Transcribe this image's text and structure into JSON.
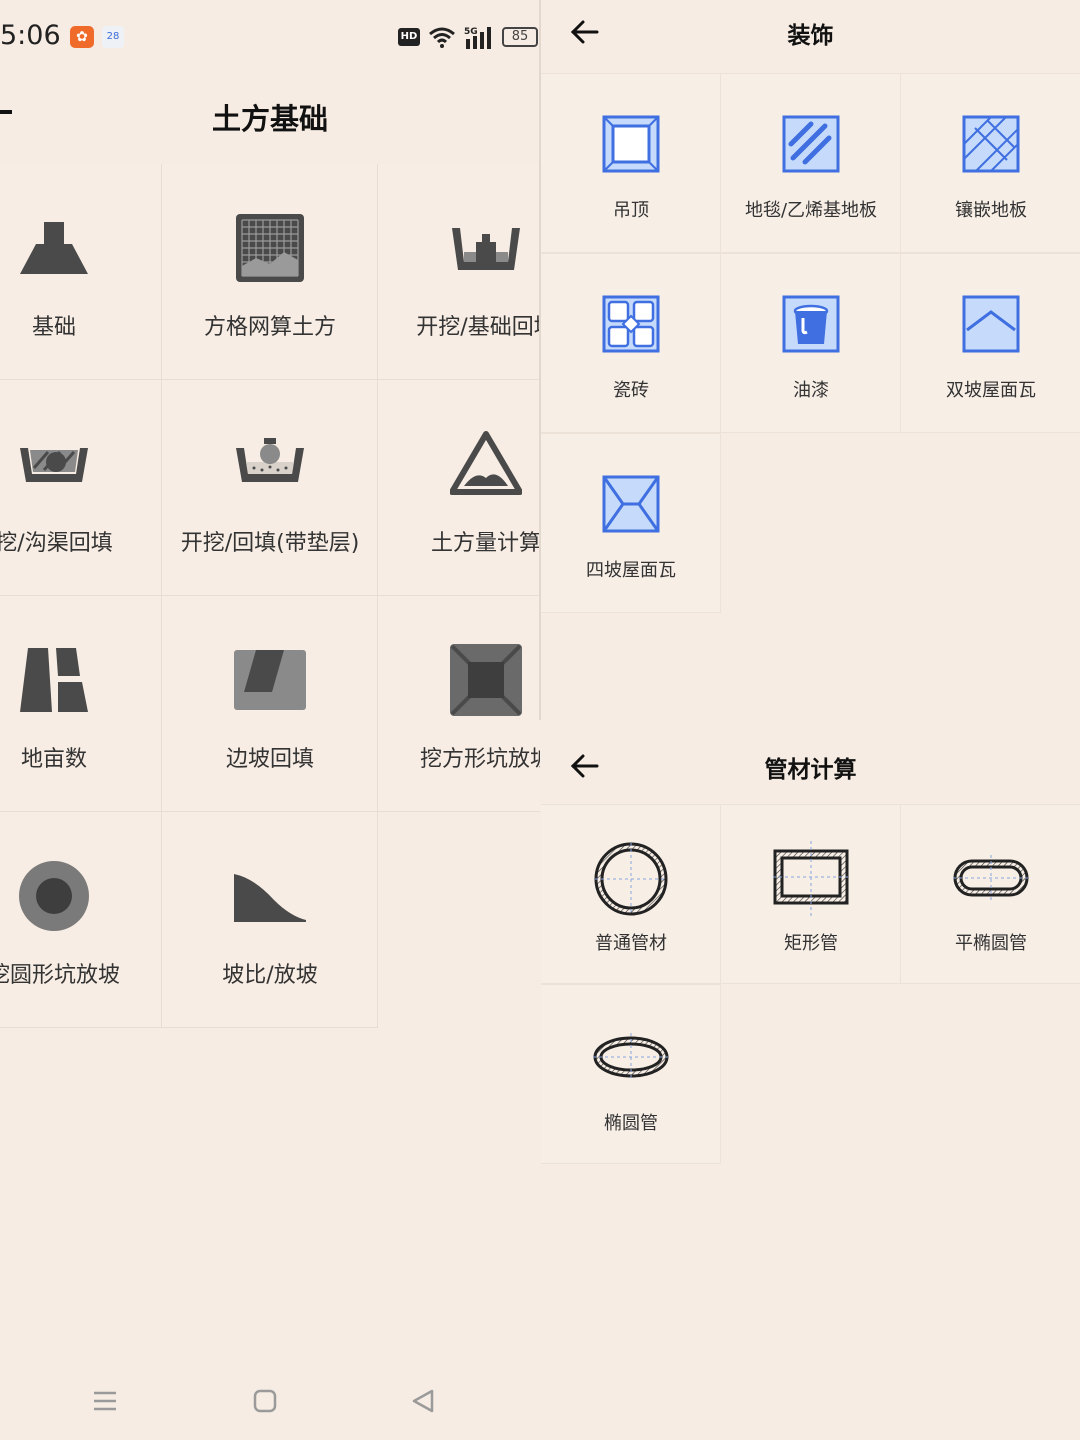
{
  "status_bar": {
    "time": "5:06",
    "app_badge_2": "28",
    "network": "5G",
    "battery": "85"
  },
  "left": {
    "title": "土方基础",
    "items": [
      {
        "label": "基础",
        "icon": "foundation-icon"
      },
      {
        "label": "方格网算土方",
        "icon": "grid-earthwork-icon"
      },
      {
        "label": "开挖/基础回填",
        "icon": "excavation-backfill-icon"
      },
      {
        "label": "挖/沟渠回填",
        "icon": "trench-backfill-icon"
      },
      {
        "label": "开挖/回填(带垫层)",
        "icon": "excavation-cushion-icon"
      },
      {
        "label": "土方量计算",
        "icon": "earthwork-volume-icon"
      },
      {
        "label": "地亩数",
        "icon": "land-area-icon"
      },
      {
        "label": "边坡回填",
        "icon": "slope-backfill-icon"
      },
      {
        "label": "挖方形坑放坡",
        "icon": "square-pit-icon"
      },
      {
        "label": "挖圆形坑放坡",
        "icon": "round-pit-icon"
      },
      {
        "label": "坡比/放坡",
        "icon": "slope-ratio-icon"
      }
    ]
  },
  "decoration": {
    "title": "装饰",
    "items": [
      {
        "label": "吊顶",
        "icon": "ceiling-icon"
      },
      {
        "label": "地毯/乙烯基地板",
        "icon": "carpet-floor-icon"
      },
      {
        "label": "镶嵌地板",
        "icon": "parquet-floor-icon"
      },
      {
        "label": "瓷砖",
        "icon": "tile-icon"
      },
      {
        "label": "油漆",
        "icon": "paint-bucket-icon"
      },
      {
        "label": "双坡屋面瓦",
        "icon": "gable-roof-icon"
      },
      {
        "label": "四坡屋面瓦",
        "icon": "hip-roof-icon"
      }
    ]
  },
  "pipe": {
    "title": "管材计算",
    "items": [
      {
        "label": "普通管材",
        "icon": "round-pipe-icon"
      },
      {
        "label": "矩形管",
        "icon": "rect-pipe-icon"
      },
      {
        "label": "平椭圆管",
        "icon": "flat-oval-pipe-icon"
      },
      {
        "label": "椭圆管",
        "icon": "oval-pipe-icon"
      }
    ]
  },
  "colors": {
    "background": "#f6ece3",
    "decor_icon_blue": "#3f6fe0",
    "decor_icon_fill": "#c6dbfb",
    "earth_icon_gray": "#4a4a4a"
  }
}
